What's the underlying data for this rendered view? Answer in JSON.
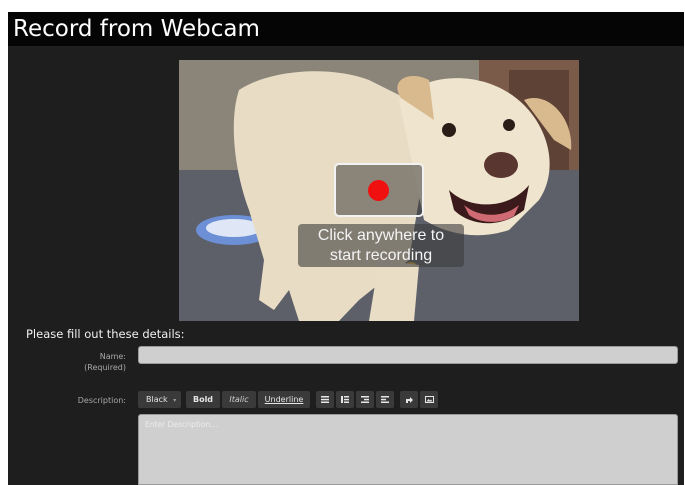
{
  "window": {
    "title": "Record from Webcam"
  },
  "webcam": {
    "overlay_text_line1": "Click anywhere to",
    "overlay_text_line2": "start recording",
    "record_dot_color": "#f01010"
  },
  "form": {
    "heading": "Please fill out these details:",
    "name_label": "Name:",
    "name_required": "(Required)",
    "name_value": "",
    "description_label": "Description:",
    "description_placeholder": "Enter Description...",
    "toolbar": {
      "color_select": "Black",
      "bold": "Bold",
      "italic": "Italic",
      "underline": "Underline",
      "icons": [
        "bullet-list-icon",
        "numbered-list-icon",
        "outdent-icon",
        "indent-icon",
        "link-icon",
        "image-icon"
      ]
    }
  }
}
